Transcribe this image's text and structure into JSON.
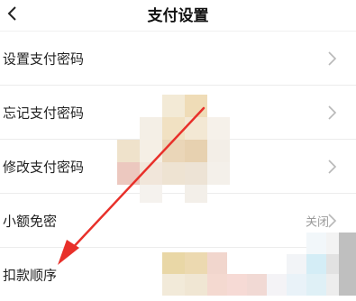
{
  "header": {
    "title": "支付设置"
  },
  "settings": [
    {
      "label": "设置支付密码",
      "value": ""
    },
    {
      "label": "忘记支付密码",
      "value": ""
    },
    {
      "label": "修改支付密码",
      "value": ""
    },
    {
      "label": "小额免密",
      "value": "关闭"
    },
    {
      "label": "扣款顺序",
      "value": ""
    }
  ],
  "colors": {
    "arrow": "#e8302a",
    "chevron": "#b8b8b8"
  },
  "icons": {
    "back": "chevron-left-icon",
    "row": "chevron-right-icon"
  }
}
